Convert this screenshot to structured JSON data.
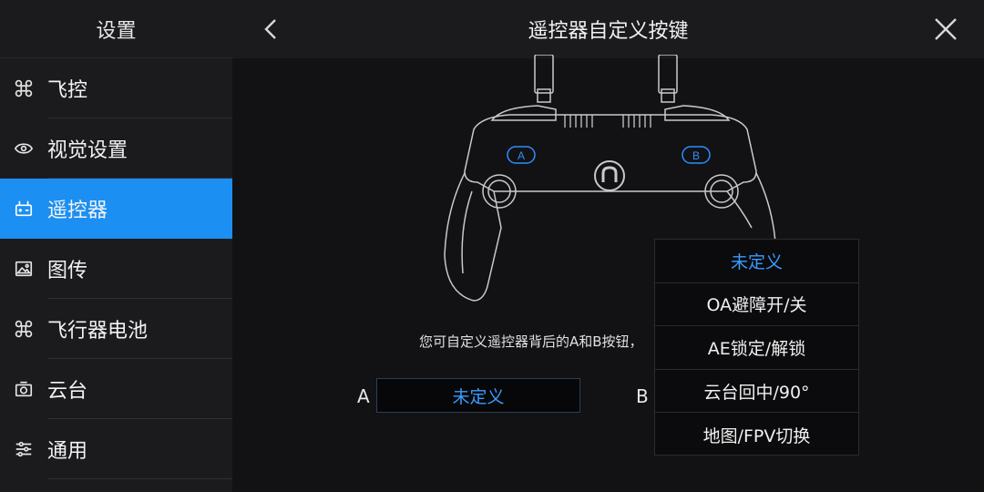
{
  "sidebar": {
    "title": "设置",
    "items": [
      {
        "label": "飞控",
        "icon": "drone-icon"
      },
      {
        "label": "视觉设置",
        "icon": "eye-icon"
      },
      {
        "label": "遥控器",
        "icon": "remote-controller-icon",
        "active": true
      },
      {
        "label": "图传",
        "icon": "image-transmission-icon"
      },
      {
        "label": "飞行器电池",
        "icon": "aircraft-battery-icon"
      },
      {
        "label": "云台",
        "icon": "gimbal-camera-icon"
      },
      {
        "label": "通用",
        "icon": "sliders-icon"
      }
    ]
  },
  "header": {
    "title": "遥控器自定义按键"
  },
  "main": {
    "hint": "您可自定义遥控器背后的A和B按钮，",
    "controller_button_a": "A",
    "controller_button_b": "B",
    "assign_a": {
      "label": "A",
      "value": "未定义"
    },
    "assign_b": {
      "label": "B"
    },
    "dropdown": {
      "options": [
        "未定义",
        "OA避障开/关",
        "AE锁定/解锁",
        "云台回中/90°",
        "地图/FPV切换"
      ],
      "selected": "未定义"
    }
  },
  "colors": {
    "accent": "#1b8ff2",
    "selected_text": "#3a9cff",
    "sidebar_bg": "#1b1b1e",
    "main_bg": "#121214"
  }
}
